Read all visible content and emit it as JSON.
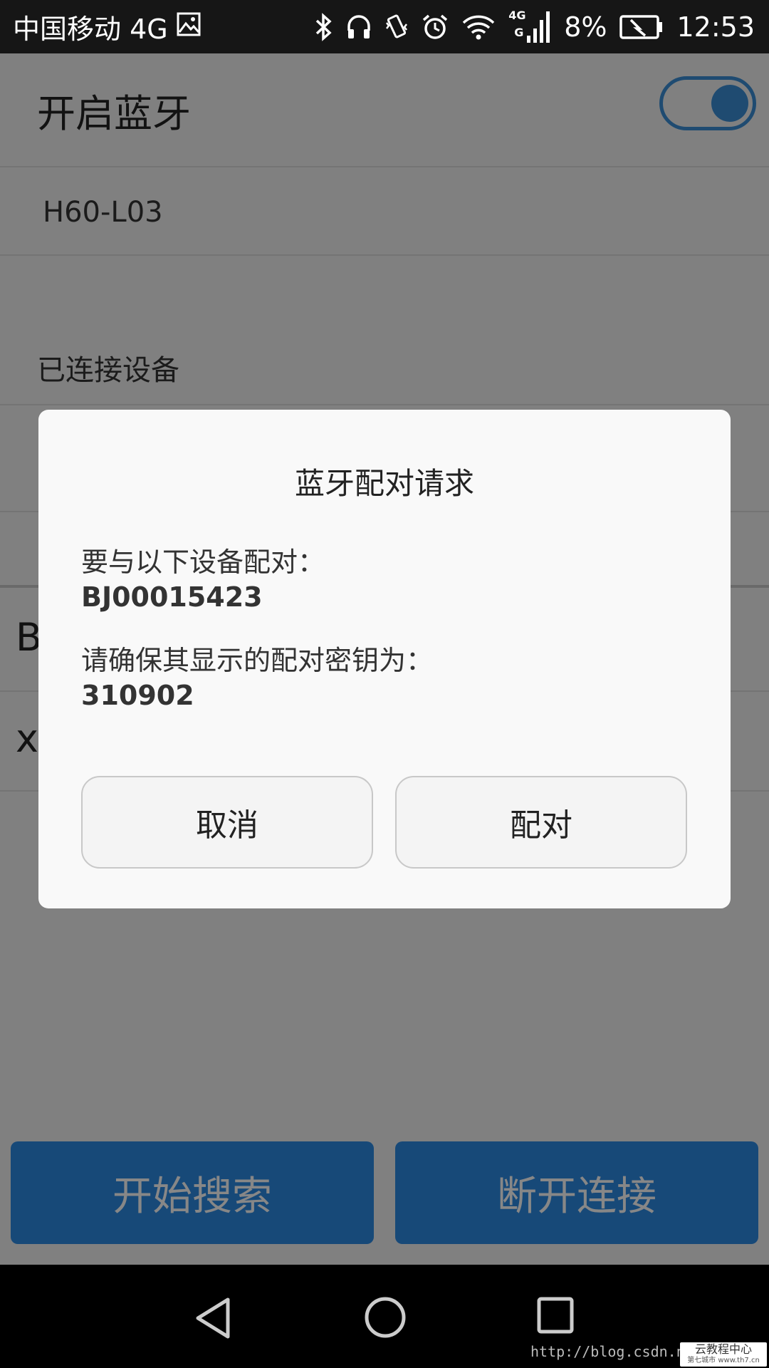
{
  "status_bar": {
    "carrier": "中国移动 4G",
    "network_badge_top": "4G",
    "network_badge_bottom": "G",
    "battery": "8%",
    "time": "12:53"
  },
  "bluetooth": {
    "title": "开启蓝牙",
    "enabled": true,
    "device_name": "H60-L03",
    "section_title": "已连接设备",
    "items": [
      {
        "label": "B"
      },
      {
        "label": "x"
      }
    ]
  },
  "buttons": {
    "start_search": "开始搜索",
    "disconnect": "断开连接"
  },
  "dialog": {
    "title": "蓝牙配对请求",
    "pair_with_label": "要与以下设备配对：",
    "device_id": "BJ00015423",
    "confirm_key_label": "请确保其显示的配对密钥为：",
    "pass_key": "310902",
    "cancel": "取消",
    "pair": "配对"
  },
  "watermark": {
    "url": "http://blog.csdn.net",
    "badge": "云教程中心",
    "badge_sub": "第七城市  www.th7.cn"
  },
  "colors": {
    "accent": "#2d8ae3",
    "toggle": "#3b8fd6"
  }
}
